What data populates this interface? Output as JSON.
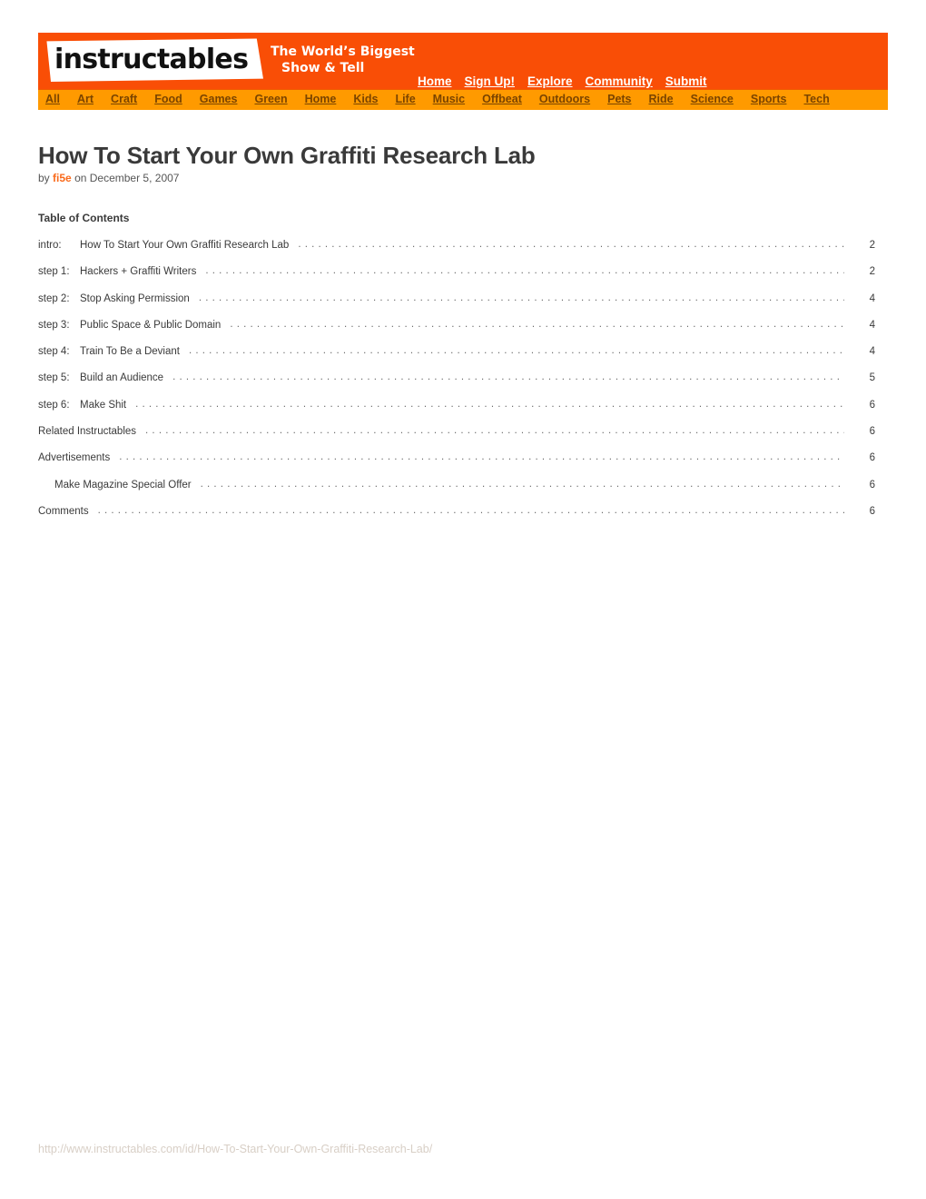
{
  "header": {
    "logo_text": "instructables",
    "tagline_line1": "The World’s Biggest",
    "tagline_line2": "Show & Tell",
    "top_nav": [
      {
        "label": "Home"
      },
      {
        "label": "Sign Up!"
      },
      {
        "label": "Explore"
      },
      {
        "label": "Community"
      },
      {
        "label": "Submit"
      }
    ],
    "categories": [
      {
        "label": "All"
      },
      {
        "label": "Art"
      },
      {
        "label": "Craft"
      },
      {
        "label": "Food"
      },
      {
        "label": "Games"
      },
      {
        "label": "Green"
      },
      {
        "label": "Home"
      },
      {
        "label": "Kids"
      },
      {
        "label": "Life"
      },
      {
        "label": "Music"
      },
      {
        "label": "Offbeat"
      },
      {
        "label": "Outdoors"
      },
      {
        "label": "Pets"
      },
      {
        "label": "Ride"
      },
      {
        "label": "Science"
      },
      {
        "label": "Sports"
      },
      {
        "label": "Tech"
      }
    ],
    "colors": {
      "top_bar": "#f94e06",
      "category_bar": "#ff9a00",
      "category_link": "#7a4400",
      "accent": "#f96a1b"
    }
  },
  "article": {
    "title": "How To Start Your Own Graffiti Research Lab",
    "byline_prefix": "by",
    "author": "fi5e",
    "byline_suffix": "on December 5, 2007"
  },
  "toc": {
    "heading": "Table of Contents",
    "entries": [
      {
        "label": "intro:",
        "title": "How To Start Your Own Graffiti Research Lab",
        "page": "2",
        "indent": false
      },
      {
        "label": "step 1:",
        "title": "Hackers + Graffiti Writers",
        "page": "2",
        "indent": false
      },
      {
        "label": "step 2:",
        "title": "Stop Asking Permission",
        "page": "4",
        "indent": false
      },
      {
        "label": "step 3:",
        "title": "Public Space & Public Domain",
        "page": "4",
        "indent": false
      },
      {
        "label": "step 4:",
        "title": "Train To Be a Deviant",
        "page": "4",
        "indent": false
      },
      {
        "label": "step 5:",
        "title": "Build an Audience",
        "page": "5",
        "indent": false
      },
      {
        "label": "step 6:",
        "title": "Make Shit",
        "page": "6",
        "indent": false
      },
      {
        "label": "",
        "title": "Related Instructables",
        "page": "6",
        "indent": false
      },
      {
        "label": "",
        "title": "Advertisements",
        "page": "6",
        "indent": false
      },
      {
        "label": "",
        "title": "Make Magazine Special Offer",
        "page": "6",
        "indent": true
      },
      {
        "label": "",
        "title": "Comments",
        "page": "6",
        "indent": false
      }
    ]
  },
  "footer": {
    "url": "http://www.instructables.com/id/How-To-Start-Your-Own-Graffiti-Research-Lab/"
  }
}
